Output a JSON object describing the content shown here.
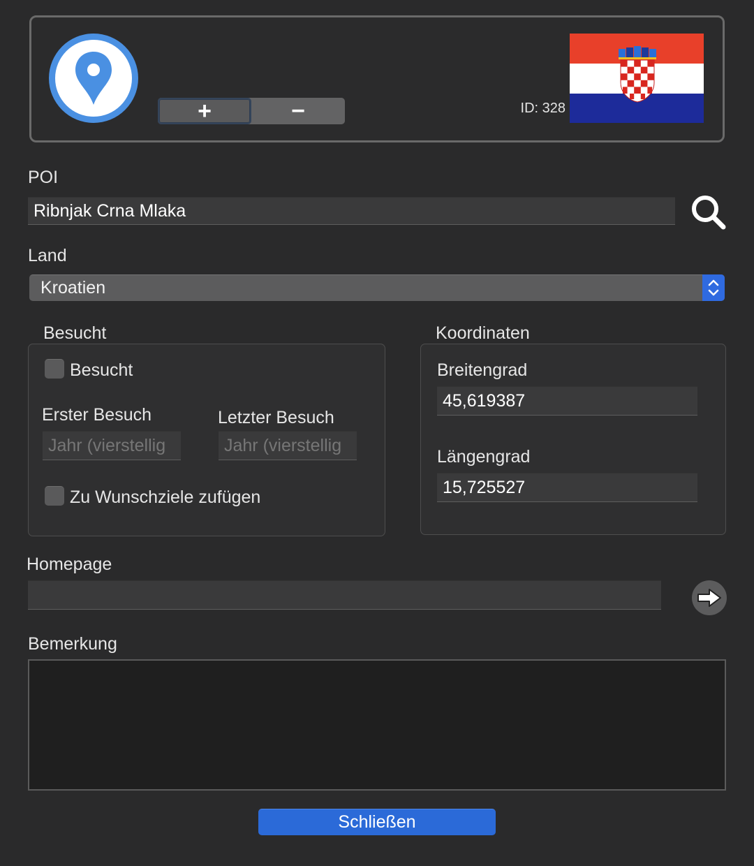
{
  "header": {
    "add_button_label": "+",
    "remove_button_label": "−",
    "id_text": "ID: 328",
    "flag_colors": {
      "red": "#e8402a",
      "white": "#ffffff",
      "blue": "#1d2b9a"
    }
  },
  "poi": {
    "label": "POI",
    "value": "Ribnjak Crna Mlaka"
  },
  "country": {
    "label": "Land",
    "selected": "Kroatien"
  },
  "visited": {
    "group_label": "Besucht",
    "checkbox_label": "Besucht",
    "first_visit_label": "Erster Besuch",
    "last_visit_label": "Letzter Besuch",
    "first_visit_placeholder": "Jahr (vierstellig",
    "last_visit_placeholder": "Jahr (vierstellig",
    "wishlist_label": "Zu Wunschziele zufügen"
  },
  "coordinates": {
    "group_label": "Koordinaten",
    "latitude_label": "Breitengrad",
    "latitude_value": "45,619387",
    "longitude_label": "Längengrad",
    "longitude_value": "15,725527"
  },
  "homepage": {
    "label": "Homepage",
    "value": ""
  },
  "remark": {
    "label": "Bemerkung",
    "value": ""
  },
  "close_button_label": "Schließen",
  "colors": {
    "accent": "#2b6ad8",
    "poi_icon": "#4a90e2"
  }
}
